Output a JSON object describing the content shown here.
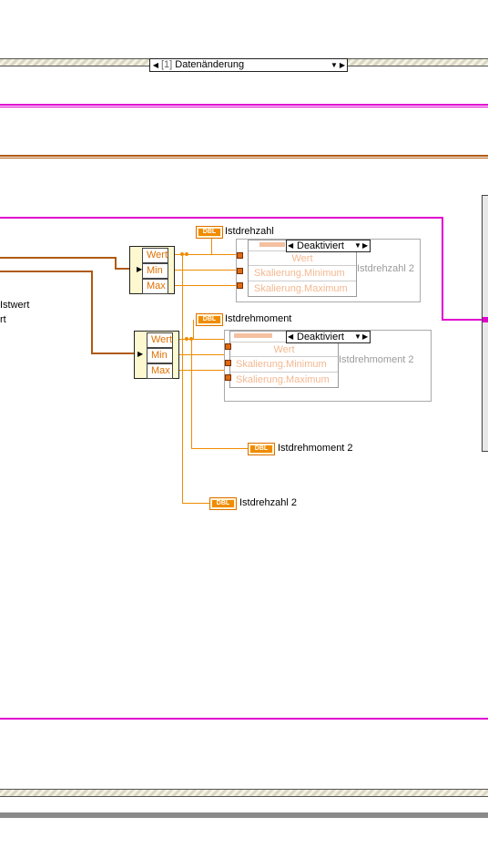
{
  "case_structure": {
    "selector_index": "[1]",
    "selector_label": "Datenänderung"
  },
  "left_labels": {
    "istwert": "Istwert",
    "fragment": "rt"
  },
  "unbundle_1": {
    "items": [
      "Wert",
      "Min",
      "Max"
    ]
  },
  "unbundle_2": {
    "items": [
      "Wert",
      "Min",
      "Max"
    ]
  },
  "indicators": {
    "istdrehzahl": "Istdrehzahl",
    "istdrehmoment": "Istdrehmoment",
    "istdrehmoment_2": "Istdrehmoment 2",
    "istdrehzahl_2": "Istdrehzahl 2",
    "type_tag": "DBL"
  },
  "property_node_1": {
    "ring_value": "Deaktiviert",
    "rows": [
      "Wert",
      "Skalierung.Minimum",
      "Skalierung.Maximum"
    ],
    "ghost_label": "Istdrehzahl 2"
  },
  "property_node_2": {
    "ring_value": "Deaktiviert",
    "rows": [
      "Wert",
      "Skalierung.Minimum",
      "Skalierung.Maximum"
    ],
    "ghost_label": "Istdrehmoment 2"
  },
  "colors": {
    "pink_wire": "#e000d0",
    "brown_wire": "#b05a10",
    "orange_wire": "#f08c00"
  }
}
